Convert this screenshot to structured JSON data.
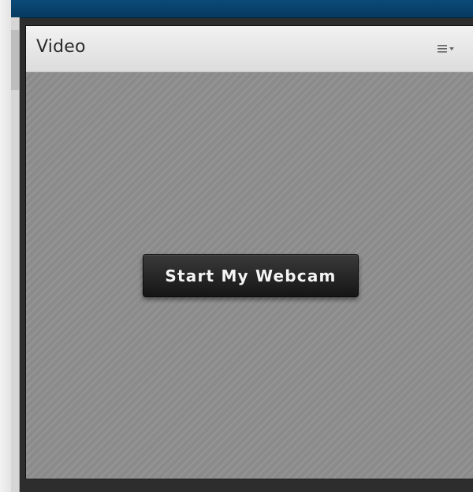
{
  "pod": {
    "title": "Video",
    "menu_icon": "hamburger-dropdown-icon"
  },
  "video": {
    "start_button_label": "Start My Webcam"
  },
  "colors": {
    "top_bar": "#0b4a78",
    "pod_frame": "#2d2d2d",
    "video_background": "#8b8b8b",
    "button_background": "#1e1e1e",
    "button_text": "#f4f4f4"
  }
}
